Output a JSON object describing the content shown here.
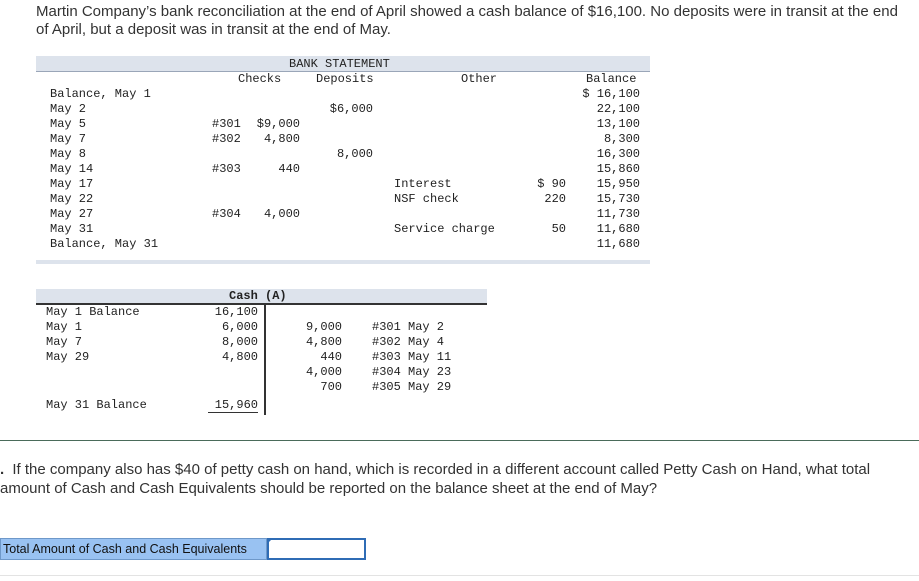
{
  "intro": "Martin Company’s bank reconciliation at the end of April showed a cash balance of $16,100. No deposits were in transit at the end of April, but a deposit was in transit at the end of May.",
  "bank_statement": {
    "title": "BANK STATEMENT",
    "headers": {
      "checks": "Checks",
      "deposits": "Deposits",
      "other": "Other",
      "balance": "Balance"
    },
    "rows": [
      {
        "date": "Balance, May 1",
        "check_no": "",
        "check_amt": "",
        "deposit": "",
        "other_desc": "",
        "other_amt": "",
        "balance": "$ 16,100"
      },
      {
        "date": "May 2",
        "check_no": "",
        "check_amt": "",
        "deposit": "$6,000",
        "other_desc": "",
        "other_amt": "",
        "balance": "22,100"
      },
      {
        "date": "May 5",
        "check_no": "#301",
        "check_amt": "$9,000",
        "deposit": "",
        "other_desc": "",
        "other_amt": "",
        "balance": "13,100"
      },
      {
        "date": "May 7",
        "check_no": "#302",
        "check_amt": "4,800",
        "deposit": "",
        "other_desc": "",
        "other_amt": "",
        "balance": "8,300"
      },
      {
        "date": "May 8",
        "check_no": "",
        "check_amt": "",
        "deposit": "8,000",
        "other_desc": "",
        "other_amt": "",
        "balance": "16,300"
      },
      {
        "date": "May 14",
        "check_no": "#303",
        "check_amt": "440",
        "deposit": "",
        "other_desc": "",
        "other_amt": "",
        "balance": "15,860"
      },
      {
        "date": "May 17",
        "check_no": "",
        "check_amt": "",
        "deposit": "",
        "other_desc": "Interest",
        "other_amt": "$ 90",
        "balance": "15,950"
      },
      {
        "date": "May 22",
        "check_no": "",
        "check_amt": "",
        "deposit": "",
        "other_desc": "NSF check",
        "other_amt": "220",
        "balance": "15,730"
      },
      {
        "date": "May 27",
        "check_no": "#304",
        "check_amt": "4,000",
        "deposit": "",
        "other_desc": "",
        "other_amt": "",
        "balance": "11,730"
      },
      {
        "date": "May 31",
        "check_no": "",
        "check_amt": "",
        "deposit": "",
        "other_desc": "Service charge",
        "other_amt": "50",
        "balance": "11,680"
      },
      {
        "date": "Balance, May 31",
        "check_no": "",
        "check_amt": "",
        "deposit": "",
        "other_desc": "",
        "other_amt": "",
        "balance": "11,680"
      }
    ]
  },
  "cash_account": {
    "title": "Cash (A)",
    "debits": [
      {
        "label": "May 1 Balance",
        "amount": "16,100"
      },
      {
        "label": "May 1",
        "amount": "6,000"
      },
      {
        "label": "May 7",
        "amount": "8,000"
      },
      {
        "label": "May 29",
        "amount": "4,800"
      }
    ],
    "credits": [
      {
        "amount": "9,000",
        "ref": "#301 May 2"
      },
      {
        "amount": "4,800",
        "ref": "#302 May 4"
      },
      {
        "amount": "440",
        "ref": "#303 May 11"
      },
      {
        "amount": "4,000",
        "ref": "#304 May 23"
      },
      {
        "amount": "700",
        "ref": "#305 May 29"
      }
    ],
    "ending": {
      "label": "May 31 Balance",
      "amount": "15,960"
    }
  },
  "question": {
    "prefix": ".",
    "text": "If the company also has $40 of petty cash on hand, which is recorded in a different account called Petty Cash on Hand, what total amount of Cash and Cash Equivalents should be reported on the balance sheet at the end of May?"
  },
  "answer": {
    "label": "Total Amount of Cash and Cash Equivalents",
    "value": ""
  }
}
